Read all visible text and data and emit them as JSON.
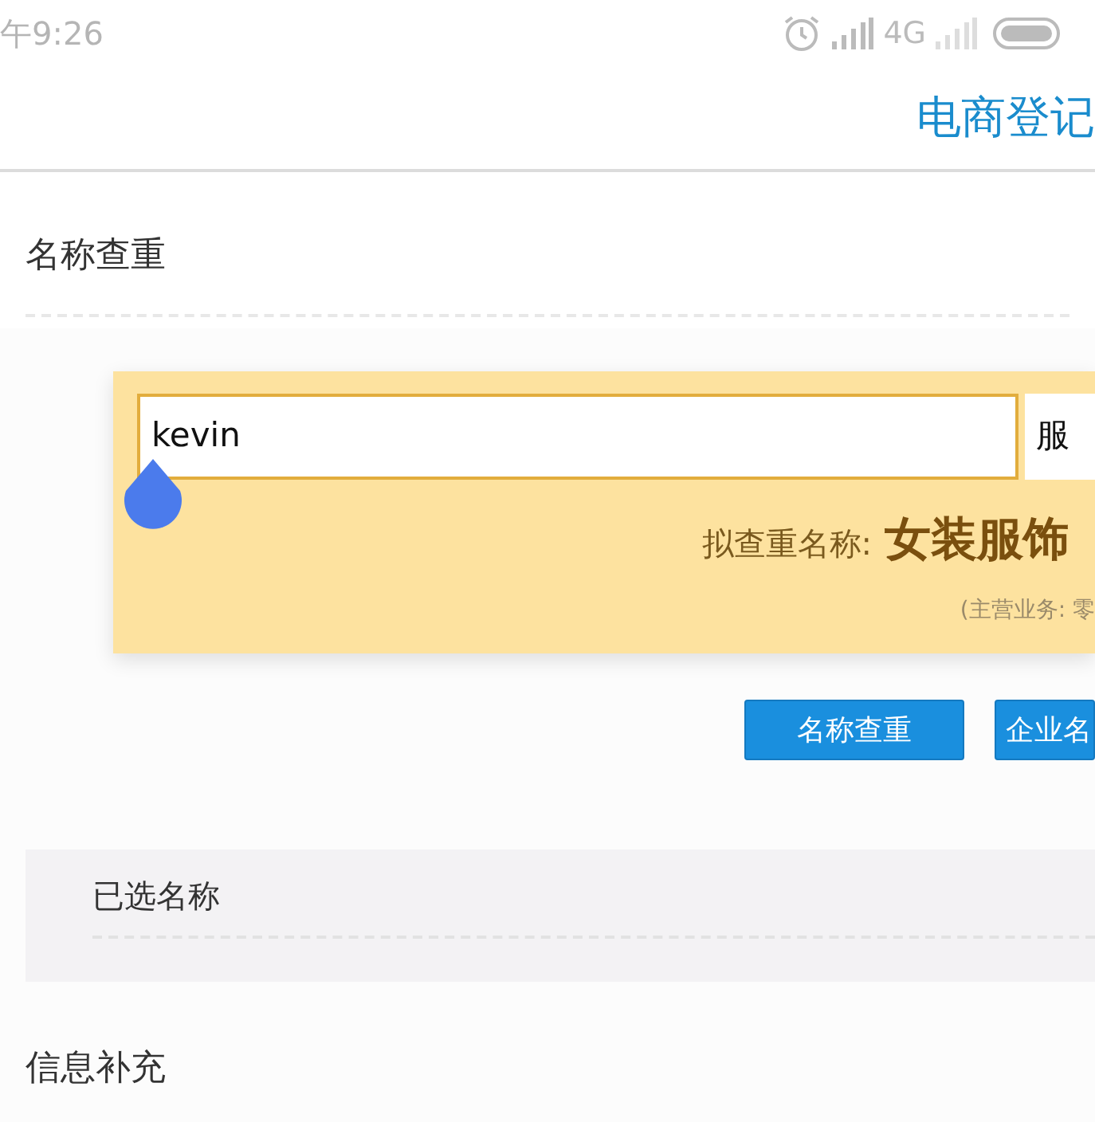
{
  "status_bar": {
    "time": "午9:26",
    "network": "4G"
  },
  "header": {
    "title": "电商登记"
  },
  "name_check": {
    "heading": "名称查重",
    "input": {
      "value": "kevin"
    },
    "industry_field": {
      "value": "服"
    },
    "proposed_label": "拟查重名称:",
    "proposed_name": "女装服饰",
    "business_note": "(主营业务: 零",
    "buttons": [
      {
        "label": "名称查重"
      },
      {
        "label": "企业名"
      }
    ]
  },
  "selected_names": {
    "heading": "已选名称"
  },
  "info": {
    "heading": "信息补充"
  }
}
